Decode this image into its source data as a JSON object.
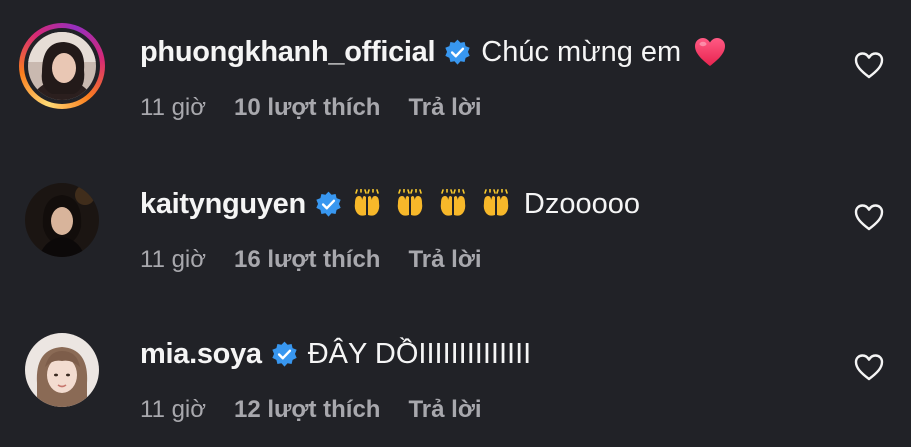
{
  "comments": [
    {
      "username": "phuongkhanh_official",
      "text": "Chúc mừng em",
      "emoji": [
        "heart"
      ],
      "time": "11 giờ",
      "likes": "10 lượt thích",
      "reply": "Trả lời",
      "has_story_ring": true
    },
    {
      "username": "kaitynguyen",
      "text": "Dzooooo",
      "emoji": [
        "raising-hands",
        "raising-hands",
        "raising-hands",
        "raising-hands"
      ],
      "time": "11 giờ",
      "likes": "16 lượt thích",
      "reply": "Trả lời",
      "has_story_ring": false
    },
    {
      "username": "mia.soya",
      "text": "ĐÂY DỒIIIIIIIIIIIIII",
      "emoji": [],
      "time": "11 giờ",
      "likes": "12 lượt thích",
      "reply": "Trả lời",
      "has_story_ring": false
    }
  ],
  "icons": {
    "verified": "verified-badge-icon",
    "like": "heart-outline-icon"
  },
  "colors": {
    "background": "#212227",
    "verified": "#3897f0",
    "secondary_text": "#a8a8ad",
    "heart_emoji": "#ff3b6b"
  }
}
